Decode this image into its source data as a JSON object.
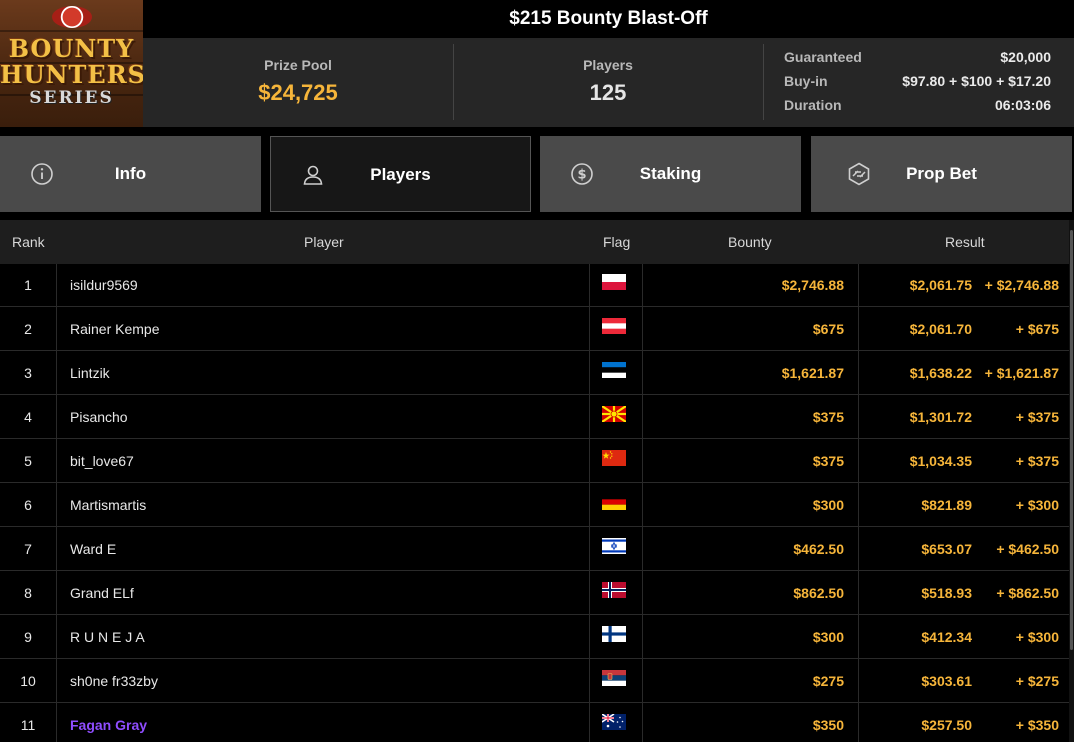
{
  "header": {
    "title": "$215 Bounty Blast-Off",
    "logo": {
      "line1": "BOUNTY",
      "line2": "HUNTERS",
      "line3": "SERIES"
    },
    "prize_pool": {
      "label": "Prize Pool",
      "value": "$24,725"
    },
    "players": {
      "label": "Players",
      "value": "125"
    },
    "details": [
      {
        "label": "Guaranteed",
        "value": "$20,000"
      },
      {
        "label": "Buy-in",
        "value": "$97.80 + $100 + $17.20"
      },
      {
        "label": "Duration",
        "value": "06:03:06"
      }
    ]
  },
  "tabs": [
    {
      "label": "Info",
      "icon": "info-icon",
      "active": false
    },
    {
      "label": "Players",
      "icon": "user-icon",
      "active": true
    },
    {
      "label": "Staking",
      "icon": "dollar-coin-icon",
      "active": false
    },
    {
      "label": "Prop Bet",
      "icon": "prop-bet-icon",
      "active": false
    }
  ],
  "table": {
    "columns": [
      "Rank",
      "Player",
      "Flag",
      "Bounty",
      "Result"
    ],
    "rows": [
      {
        "rank": "1",
        "player": "isildur9569",
        "flag": "poland-flag",
        "bounty": "$2,746.88",
        "result": "$2,061.75",
        "result_bounty": "+ $2,746.88"
      },
      {
        "rank": "2",
        "player": "Rainer Kempe",
        "flag": "austria-flag",
        "bounty": "$675",
        "result": "$2,061.70",
        "result_bounty": "+ $675"
      },
      {
        "rank": "3",
        "player": "Lintzik",
        "flag": "estonia-flag",
        "bounty": "$1,621.87",
        "result": "$1,638.22",
        "result_bounty": "+ $1,621.87"
      },
      {
        "rank": "4",
        "player": "Pisancho",
        "flag": "north-macedonia-flag",
        "bounty": "$375",
        "result": "$1,301.72",
        "result_bounty": "+ $375"
      },
      {
        "rank": "5",
        "player": "bit_love67",
        "flag": "china-flag",
        "bounty": "$375",
        "result": "$1,034.35",
        "result_bounty": "+ $375"
      },
      {
        "rank": "6",
        "player": "Martismartis",
        "flag": "germany-flag",
        "bounty": "$300",
        "result": "$821.89",
        "result_bounty": "+ $300"
      },
      {
        "rank": "7",
        "player": "Ward E",
        "flag": "israel-flag",
        "bounty": "$462.50",
        "result": "$653.07",
        "result_bounty": "+ $462.50"
      },
      {
        "rank": "8",
        "player": "Grand ELf",
        "flag": "norway-flag",
        "bounty": "$862.50",
        "result": "$518.93",
        "result_bounty": "+ $862.50"
      },
      {
        "rank": "9",
        "player": "R U N E J A",
        "flag": "finland-flag",
        "bounty": "$300",
        "result": "$412.34",
        "result_bounty": "+ $300"
      },
      {
        "rank": "10",
        "player": "sh0ne fr33zby",
        "flag": "serbia-flag",
        "bounty": "$275",
        "result": "$303.61",
        "result_bounty": "+ $275"
      },
      {
        "rank": "11",
        "player": "Fagan Gray",
        "flag": "australia-flag",
        "bounty": "$350",
        "result": "$257.50",
        "result_bounty": "+ $350",
        "highlighted": true
      }
    ]
  },
  "colors": {
    "accent_gold": "#f6b53a",
    "highlight_purple": "#8f4dff",
    "tab_bg": "#4a4a4a",
    "active_tab_bg": "#171717"
  }
}
